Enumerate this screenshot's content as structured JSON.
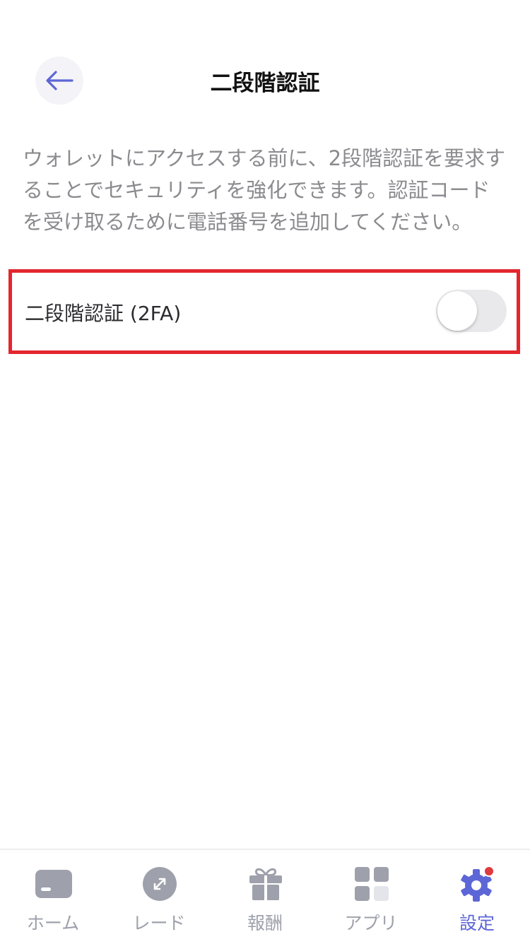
{
  "header": {
    "title": "二段階認証",
    "back_icon": "arrow-left-icon"
  },
  "description": "ウォレットにアクセスする前に、2段階認証を要求することでセキュリティを強化できます。認証コードを受け取るために電話番号を追加してください。",
  "setting": {
    "label": "二段階認証 (2FA)",
    "enabled": false
  },
  "tabbar": {
    "items": [
      {
        "label": "ホーム",
        "icon": "card-icon"
      },
      {
        "label": "レード",
        "icon": "trade-icon"
      },
      {
        "label": "報酬",
        "icon": "gift-icon"
      },
      {
        "label": "アプリ",
        "icon": "apps-icon"
      },
      {
        "label": "設定",
        "icon": "gear-icon",
        "active": true,
        "badge": true
      }
    ]
  },
  "colors": {
    "accent": "#5d66d6",
    "highlight_border": "#e3262e",
    "inactive_icon": "#9ea1ab",
    "badge": "#e0393e"
  }
}
